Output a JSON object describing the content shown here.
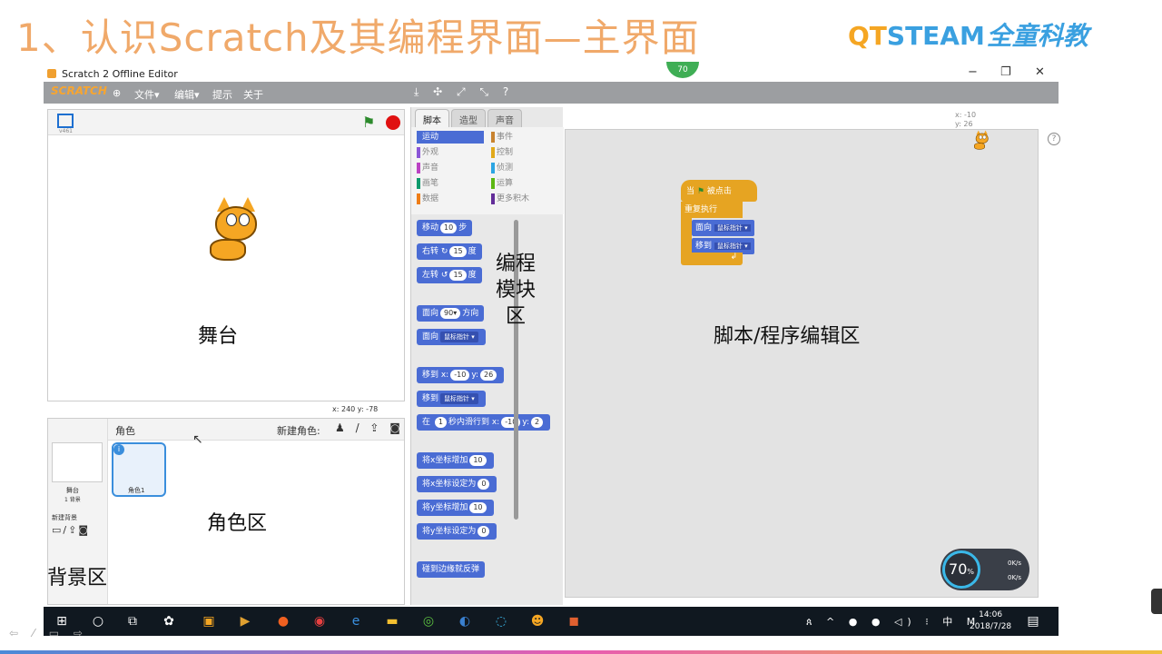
{
  "slide": {
    "title": "1、认识Scratch及其编程界面—主界面",
    "logo_q": "QT",
    "logo_t": "STEAM",
    "logo_cn": "全童科教"
  },
  "window": {
    "title": "Scratch 2 Offline Editor",
    "minimize": "−",
    "maximize": "❐",
    "close": "✕",
    "badge": "70"
  },
  "menubar": {
    "brand": "SCRATCH",
    "file": "文件▾",
    "edit": "编辑▾",
    "tips": "提示",
    "about": "关于",
    "tools": "⤓ ✣ ⤢ ⤡ ?"
  },
  "stage": {
    "version": "v461",
    "coords": "x: 240   y: -78",
    "label": "舞台"
  },
  "sprites": {
    "header": "角色",
    "new_sprite": "新建角色:",
    "new_icons": "♟ / ⇪ ◙",
    "stage_name": "舞台",
    "backdrop_count": "1 背景",
    "new_backdrop": "新建背景",
    "backdrop_icons": "▭/⇪◙",
    "sprite1_name": "角色1",
    "info": "i",
    "label": "角色区",
    "bg_label": "背景区"
  },
  "palette": {
    "tabs": [
      "脚本",
      "造型",
      "声音"
    ],
    "categories_left": [
      "运动",
      "外观",
      "声音",
      "画笔",
      "数据"
    ],
    "categories_right": [
      "事件",
      "控制",
      "侦测",
      "运算",
      "更多积木"
    ],
    "colors_left": [
      "#4a6cd4",
      "#8a55d7",
      "#bb42c3",
      "#0e9a6c",
      "#ee7d16"
    ],
    "colors_right": [
      "#c88330",
      "#e1a91a",
      "#2ca5e2",
      "#5cb712",
      "#632d99"
    ],
    "blocks": {
      "move": "移动",
      "move_val": "10",
      "move_unit": "步",
      "turn_right": "右转",
      "turn_right_icon": "↻",
      "turn_right_val": "15",
      "turn_right_unit": "度",
      "turn_left": "左转",
      "turn_left_icon": "↺",
      "turn_left_val": "15",
      "turn_left_unit": "度",
      "point_dir": "面向",
      "point_dir_val": "90▾",
      "point_dir_unit": "方向",
      "point_towards": "面向",
      "point_towards_val": "鼠标指针 ▾",
      "goto_xy": "移到 x:",
      "goto_x": "-10",
      "goto_y_lbl": "y:",
      "goto_y": "26",
      "goto": "移到",
      "goto_val": "鼠标指针 ▾",
      "glide": "在",
      "glide_secs": "1",
      "glide_text": "秒内滑行到 x:",
      "glide_x": "-10",
      "glide_y_lbl": "y:",
      "glide_y": "2",
      "change_x": "将x坐标增加",
      "change_x_val": "10",
      "set_x": "将x坐标设定为",
      "set_x_val": "0",
      "change_y": "将y坐标增加",
      "change_y_val": "10",
      "set_y": "将y坐标设定为",
      "set_y_val": "0",
      "bounce": "碰到边缘就反弹"
    },
    "label": "编程模块区"
  },
  "script": {
    "hat": "当",
    "hat_flag": "⚑",
    "hat_rest": "被点击",
    "forever": "重复执行",
    "point": "面向",
    "point_val": "鼠标指针 ▾",
    "goto": "移到",
    "goto_val": "鼠标指针 ▾",
    "forever_end": "↲",
    "coords_x": "x: -10",
    "coords_y": "y: 26",
    "help": "?",
    "label": "脚本/程序编辑区"
  },
  "meter": {
    "percent": "70",
    "unit": "%",
    "up": "0K/s",
    "down": "0K/s"
  },
  "taskbar": {
    "tray": "ጰ ^ ● ● ◁) ⁝ 中 M",
    "time": "14:06",
    "date": "2018/7/28"
  }
}
